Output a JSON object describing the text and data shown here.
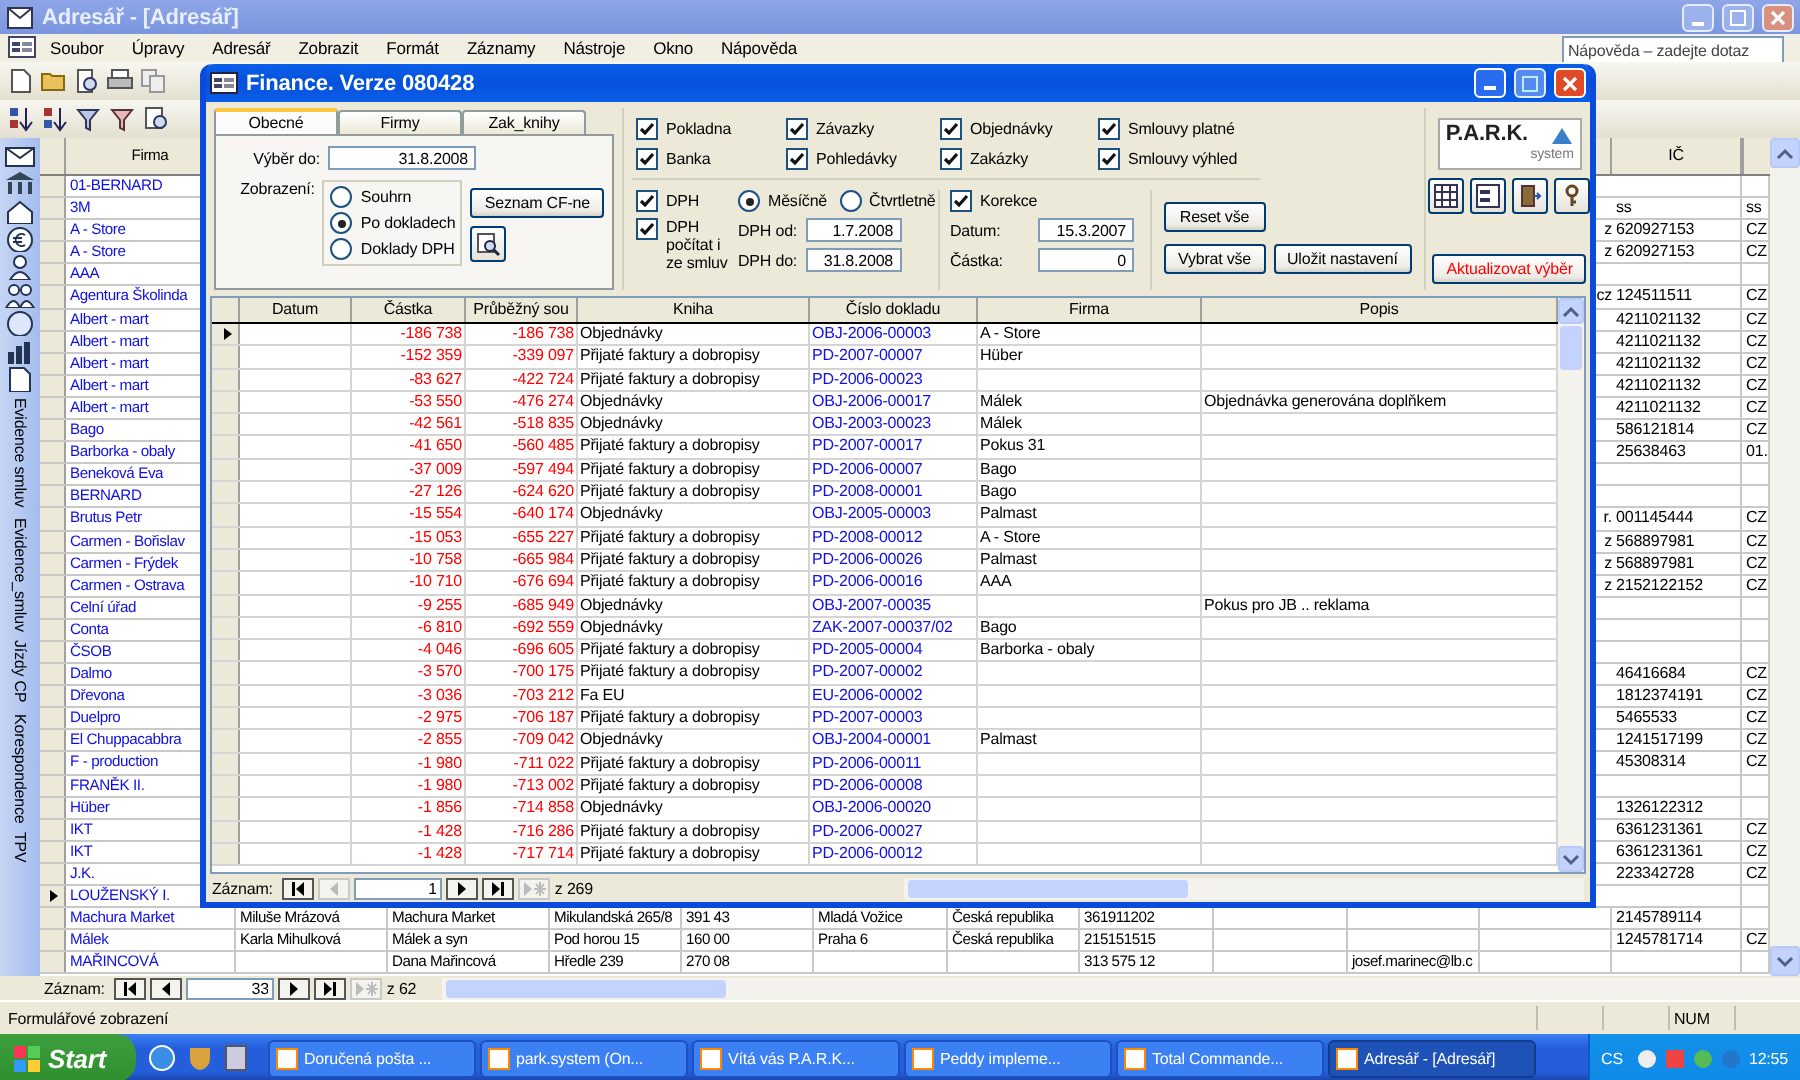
{
  "window": {
    "title": "Adresář - [Adresář]"
  },
  "menu": [
    "Soubor",
    "Úpravy",
    "Adresář",
    "Zobrazit",
    "Formát",
    "Záznamy",
    "Nástroje",
    "Okno",
    "Nápověda"
  ],
  "help_box": {
    "placeholder": "Nápověda – zadejte dotaz"
  },
  "sidebar": {
    "labels": [
      "Evidence smluv",
      "Evidence_smluv",
      "Jízdy CP",
      "Korespondence",
      "TPV"
    ]
  },
  "datasheet": {
    "columns": {
      "firma": "Firma",
      "ic": "IČ"
    },
    "rows": [
      {
        "firma": "01-BERNARD",
        "selected": false
      },
      {
        "firma": "3M",
        "ic": "ss",
        "column_13": "ss",
        "selected": false
      },
      {
        "firma": "A - Store",
        "cut": "z",
        "ic": "620927153",
        "column_13": "CZ",
        "selected": false
      },
      {
        "firma": "A - Store",
        "cut": "z",
        "ic": "620927153",
        "column_13": "CZ",
        "selected": false
      },
      {
        "firma": "AAA",
        "selected": false
      },
      {
        "firma": "Agentura Školinda",
        "cut": "cz",
        "ic": "124511511",
        "column_13": "CZ",
        "selected": false
      },
      {
        "firma": "Albert - mart",
        "ic": "4211021132",
        "column_13": "CZ",
        "selected": false
      },
      {
        "firma": "Albert - mart",
        "ic": "4211021132",
        "column_13": "CZ",
        "selected": false
      },
      {
        "firma": "Albert - mart",
        "ic": "4211021132",
        "column_13": "CZ",
        "selected": false
      },
      {
        "firma": "Albert - mart",
        "ic": "4211021132",
        "column_13": "CZ",
        "selected": false
      },
      {
        "firma": "Albert - mart",
        "ic": "4211021132",
        "column_13": "CZ",
        "selected": false
      },
      {
        "firma": "Bago",
        "ic": "586121814",
        "column_13": "CZ",
        "selected": false
      },
      {
        "firma": "Barborka - obaly",
        "ic": "25638463",
        "column_13": "01.",
        "selected": false
      },
      {
        "firma": "Beneková Eva",
        "selected": false
      },
      {
        "firma": "BERNARD",
        "selected": false
      },
      {
        "firma": "Brutus Petr",
        "cut": "r.",
        "ic": "001145444",
        "column_13": "CZ",
        "selected": false
      },
      {
        "firma": "Carmen - Bořislav",
        "cut": "z",
        "ic": "568897981",
        "column_13": "CZ",
        "selected": false
      },
      {
        "firma": "Carmen - Frýdek",
        "cut": "z",
        "ic": "568897981",
        "column_13": "CZ",
        "selected": false
      },
      {
        "firma": "Carmen - Ostrava",
        "cut": "z",
        "ic": "2152122152",
        "column_13": "CZ",
        "selected": false
      },
      {
        "firma": "Celní úřad",
        "selected": false
      },
      {
        "firma": "Conta",
        "selected": false
      },
      {
        "firma": "ČSOB",
        "selected": false
      },
      {
        "firma": "Dalmo",
        "ic": "46416684",
        "column_13": "CZ",
        "selected": false
      },
      {
        "firma": "Dřevona",
        "ic": "1812374191",
        "column_13": "CZ",
        "selected": false
      },
      {
        "firma": "Duelpro",
        "ic": "5465533",
        "column_13": "CZ",
        "selected": false
      },
      {
        "firma": "El Chuppacabbra",
        "ic": "1241517199",
        "column_13": "CZ",
        "selected": false
      },
      {
        "firma": "F - production",
        "ic": "45308314",
        "column_13": "CZ",
        "selected": false
      },
      {
        "firma": "FRANĚK II.",
        "selected": false
      },
      {
        "firma": "Hüber",
        "ic": "1326122312",
        "selected": false
      },
      {
        "firma": "IKT",
        "ic": "6361231361",
        "column_13": "CZ",
        "selected": false
      },
      {
        "firma": "IKT",
        "ic": "6361231361",
        "column_13": "CZ",
        "selected": false
      },
      {
        "firma": "J.K.",
        "ic": "223342728",
        "column_13": "CZ",
        "selected": false
      },
      {
        "firma": "LOUŽENSKÝ I.",
        "selected": true
      },
      {
        "firma": "Machura Market",
        "column_2": "Miluše Mrázová",
        "column_3": "Machura Market",
        "column_4": "Mikulandská 265/8",
        "column_5": "391 43",
        "column_6": "Mladá Vožice",
        "column_7": "Česká republika",
        "column_8": "361911202",
        "ic": "2145789114",
        "selected": false
      },
      {
        "firma": "Málek",
        "column_2": "Karla Mihulková",
        "column_3": "Málek a syn",
        "column_4": "Pod horou 15",
        "column_5": "160 00",
        "column_6": "Praha 6",
        "column_7": "Česká republika",
        "column_8": "215151515",
        "ic": "1245781714",
        "column_13": "CZ",
        "selected": false
      },
      {
        "firma": "MAŘINCOVÁ",
        "column_3": "Dana Mařincová",
        "column_4": "Hředle 239",
        "column_5": "270 08",
        "column_8": "313 575 12",
        "column_10": "josef.marinec@lb.c",
        "selected": false
      }
    ],
    "nav": {
      "label": "Záznam:",
      "value": "33",
      "total": "z 62"
    }
  },
  "dialog": {
    "title": "Finance. Verze 080428",
    "tabs": [
      {
        "label": "Obecné",
        "selected": true
      },
      {
        "label": "Firmy",
        "selected": false
      },
      {
        "label": "Zak_knihy",
        "selected": false
      }
    ],
    "vyber_do": {
      "label": "Výběr do:",
      "value": "31.8.2008"
    },
    "zobrazeni": {
      "label": "Zobrazení:",
      "options": [
        {
          "label": "Souhrn",
          "selected": false
        },
        {
          "label": "Po dokladech",
          "selected": true
        },
        {
          "label": "Doklady DPH",
          "selected": false
        }
      ]
    },
    "seznam_button": "Seznam CF-ne",
    "filters": [
      {
        "label": "Pokladna",
        "checked": true
      },
      {
        "label": "Banka",
        "checked": true
      },
      {
        "label": "Závazky",
        "checked": true
      },
      {
        "label": "Pohledávky",
        "checked": true
      },
      {
        "label": "Objednávky",
        "checked": true
      },
      {
        "label": "Zakázky",
        "checked": true
      },
      {
        "label": "Smlouvy platné",
        "checked": true
      },
      {
        "label": "Smlouvy výhled",
        "checked": true
      }
    ],
    "dph": {
      "checkbox": {
        "label": "DPH",
        "checked": true
      },
      "period": [
        {
          "label": "Měsíčně",
          "selected": true
        },
        {
          "label": "Čtvrtletně",
          "selected": false
        }
      ],
      "from_contracts": {
        "label": "DPH počítat i ze smluv",
        "checked": true
      },
      "od": {
        "label": "DPH od:",
        "value": "1.7.2008"
      },
      "do": {
        "label": "DPH do:",
        "value": "31.8.2008"
      }
    },
    "korekce": {
      "label": "Korekce",
      "checked": true,
      "datum": {
        "label": "Datum:",
        "value": "15.3.2007"
      },
      "castka": {
        "label": "Částka:",
        "value": "0"
      }
    },
    "buttons": {
      "reset": "Reset vše",
      "select_all": "Vybrat vše",
      "save": "Uložit nastavení",
      "refresh": "Aktualizovat výběr"
    },
    "logo": {
      "name": "P.A.R.K.",
      "tagline": "system"
    },
    "grid": {
      "columns": [
        "Datum",
        "Částka",
        "Průběžný sou",
        "Kniha",
        "Číslo dokladu",
        "Firma",
        "Popis"
      ],
      "rows": [
        {
          "amount": "-186 738",
          "running": "-186 738",
          "book": "Objednávky",
          "doc": "OBJ-2006-00003",
          "firm": "A - Store",
          "selected": true
        },
        {
          "amount": "-152 359",
          "running": "-339 097",
          "book": "Přijaté faktury a dobropisy",
          "doc": "PD-2007-00007",
          "firm": "Hüber",
          "selected": false
        },
        {
          "amount": "-83 627",
          "running": "-422 724",
          "book": "Přijaté faktury a dobropisy",
          "doc": "PD-2006-00023",
          "selected": false
        },
        {
          "amount": "-53 550",
          "running": "-476 274",
          "book": "Objednávky",
          "doc": "OBJ-2006-00017",
          "firm": "Málek",
          "note": "Objednávka generována doplňkem",
          "selected": false
        },
        {
          "amount": "-42 561",
          "running": "-518 835",
          "book": "Objednávky",
          "doc": "OBJ-2003-00023",
          "firm": "Málek",
          "selected": false
        },
        {
          "amount": "-41 650",
          "running": "-560 485",
          "book": "Přijaté faktury a dobropisy",
          "doc": "PD-2007-00017",
          "firm": "Pokus 31",
          "selected": false
        },
        {
          "amount": "-37 009",
          "running": "-597 494",
          "book": "Přijaté faktury a dobropisy",
          "doc": "PD-2006-00007",
          "firm": "Bago",
          "selected": false
        },
        {
          "amount": "-27 126",
          "running": "-624 620",
          "book": "Přijaté faktury a dobropisy",
          "doc": "PD-2008-00001",
          "firm": "Bago",
          "selected": false
        },
        {
          "amount": "-15 554",
          "running": "-640 174",
          "book": "Objednávky",
          "doc": "OBJ-2005-00003",
          "firm": "Palmast",
          "selected": false
        },
        {
          "amount": "-15 053",
          "running": "-655 227",
          "book": "Přijaté faktury a dobropisy",
          "doc": "PD-2008-00012",
          "firm": "A - Store",
          "selected": false
        },
        {
          "amount": "-10 758",
          "running": "-665 984",
          "book": "Přijaté faktury a dobropisy",
          "doc": "PD-2006-00026",
          "firm": "Palmast",
          "selected": false
        },
        {
          "amount": "-10 710",
          "running": "-676 694",
          "book": "Přijaté faktury a dobropisy",
          "doc": "PD-2006-00016",
          "firm": "AAA",
          "selected": false
        },
        {
          "amount": "-9 255",
          "running": "-685 949",
          "book": "Objednávky",
          "doc": "OBJ-2007-00035",
          "note": "Pokus pro JB .. reklama",
          "selected": false
        },
        {
          "amount": "-6 810",
          "running": "-692 559",
          "book": "Objednávky",
          "doc": "ZAK-2007-00037/02",
          "firm": "Bago",
          "selected": false
        },
        {
          "amount": "-4 046",
          "running": "-696 605",
          "book": "Přijaté faktury a dobropisy",
          "doc": "PD-2005-00004",
          "firm": "Barborka - obaly",
          "selected": false
        },
        {
          "amount": "-3 570",
          "running": "-700 175",
          "book": "Přijaté faktury a dobropisy",
          "doc": "PD-2007-00002",
          "selected": false
        },
        {
          "amount": "-3 036",
          "running": "-703 212",
          "book": "Fa EU",
          "doc": "EU-2006-00002",
          "selected": false
        },
        {
          "amount": "-2 975",
          "running": "-706 187",
          "book": "Přijaté faktury a dobropisy",
          "doc": "PD-2007-00003",
          "selected": false
        },
        {
          "amount": "-2 855",
          "running": "-709 042",
          "book": "Objednávky",
          "doc": "OBJ-2004-00001",
          "firm": "Palmast",
          "selected": false
        },
        {
          "amount": "-1 980",
          "running": "-711 022",
          "book": "Přijaté faktury a dobropisy",
          "doc": "PD-2006-00011",
          "selected": false
        },
        {
          "amount": "-1 980",
          "running": "-713 002",
          "book": "Přijaté faktury a dobropisy",
          "doc": "PD-2006-00008",
          "selected": false
        },
        {
          "amount": "-1 856",
          "running": "-714 858",
          "book": "Objednávky",
          "doc": "OBJ-2006-00020",
          "selected": false
        },
        {
          "amount": "-1 428",
          "running": "-716 286",
          "book": "Přijaté faktury a dobropisy",
          "doc": "PD-2006-00027",
          "selected": false
        },
        {
          "amount": "-1 428",
          "running": "-717 714",
          "book": "Přijaté faktury a dobropisy",
          "doc": "PD-2006-00012",
          "selected": false
        }
      ]
    },
    "nav": {
      "label": "Záznam:",
      "value": "1",
      "total": "z 269"
    }
  },
  "status_bar": {
    "text": "Formulářové zobrazení",
    "indicator": "NUM"
  },
  "taskbar": {
    "start": "Start",
    "tasks": [
      {
        "label": "Doručená pošta ...",
        "active": false
      },
      {
        "label": "park.system (On...",
        "active": false
      },
      {
        "label": "Vítá vás P.A.R.K...",
        "active": false
      },
      {
        "label": "Peddy   impleme...",
        "active": false
      },
      {
        "label": "Total Commande...",
        "active": false
      },
      {
        "label": "Adresář - [Adresář]",
        "active": true
      }
    ],
    "language": "CS",
    "clock": "12:55"
  }
}
